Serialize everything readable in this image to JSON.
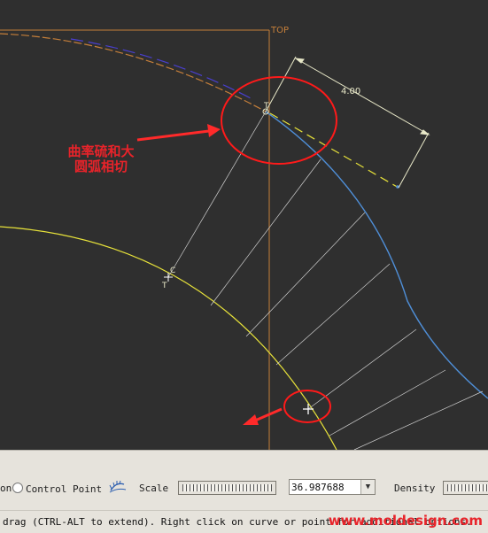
{
  "viewport": {
    "datum_label": "TOP",
    "dimension_value": "4.00",
    "point_labels": {
      "tangent_top": "T",
      "tangent_mid": "T",
      "curvature_mid": "C"
    },
    "annotation": {
      "line1": "曲率硫和大",
      "line2": "圆弧相切"
    },
    "colors": {
      "background": "#2f2f2f",
      "spline": "#4f8fd8",
      "large_arc": "#e7e23a",
      "circle": "#ff1a1a",
      "arrow": "#ff2a2a",
      "datum": "#c57f3a"
    }
  },
  "dashboard": {
    "option_partial_label": "on",
    "control_point_label": "Control Point",
    "scale_label": "Scale",
    "scale_value": "36.987688",
    "density_label": "Density"
  },
  "status_bar": {
    "message": "drag (CTRL-ALT to extend). Right click on curve or point for additional options.",
    "watermark": "www.moldesign.com"
  }
}
